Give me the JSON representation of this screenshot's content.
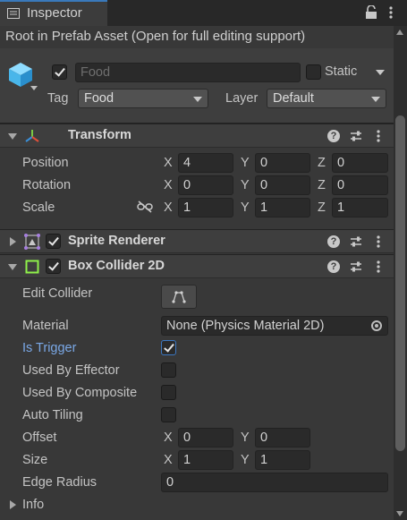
{
  "window": {
    "tab_title": "Inspector"
  },
  "prefab_notice": "Root in Prefab Asset (Open for full editing support)",
  "gameobject": {
    "active": true,
    "name": "Food",
    "static_label": "Static",
    "static_checked": false,
    "tag_label": "Tag",
    "tag_value": "Food",
    "layer_label": "Layer",
    "layer_value": "Default"
  },
  "transform": {
    "title": "Transform",
    "position": {
      "label": "Position",
      "x": "4",
      "y": "0",
      "z": "0"
    },
    "rotation": {
      "label": "Rotation",
      "x": "0",
      "y": "0",
      "z": "0"
    },
    "scale": {
      "label": "Scale",
      "x": "1",
      "y": "1",
      "z": "1"
    },
    "axis_x": "X",
    "axis_y": "Y",
    "axis_z": "Z"
  },
  "sprite_renderer": {
    "title": "Sprite Renderer",
    "enabled": true,
    "expanded": false
  },
  "box_collider": {
    "title": "Box Collider 2D",
    "enabled": true,
    "edit_collider_label": "Edit Collider",
    "material_label": "Material",
    "material_value": "None (Physics Material 2D)",
    "is_trigger_label": "Is Trigger",
    "is_trigger": true,
    "used_by_effector_label": "Used By Effector",
    "used_by_effector": false,
    "used_by_composite_label": "Used By Composite",
    "used_by_composite": false,
    "auto_tiling_label": "Auto Tiling",
    "auto_tiling": false,
    "offset": {
      "label": "Offset",
      "x": "0",
      "y": "0"
    },
    "size": {
      "label": "Size",
      "x": "1",
      "y": "1"
    },
    "edge_radius_label": "Edge Radius",
    "edge_radius": "0",
    "info_label": "Info"
  },
  "icons": {
    "tab": "inspector-icon",
    "lock": "lock-icon",
    "menu": "kebab-menu-icon",
    "gameobject": "cube-icon",
    "transform": "transform-axes-icon",
    "sprite_renderer": "sprite-renderer-icon",
    "box_collider": "box-collider-icon",
    "help": "help-icon",
    "preset": "preset-sliders-icon",
    "constrain": "constrain-proportions-icon",
    "edit_collider": "edit-collider-icon",
    "object_picker": "object-picker-icon"
  },
  "colors": {
    "accent": "#3a79bb",
    "trigger_label": "#7aa8e6",
    "panel": "#383838",
    "header": "#3e3e3e"
  }
}
